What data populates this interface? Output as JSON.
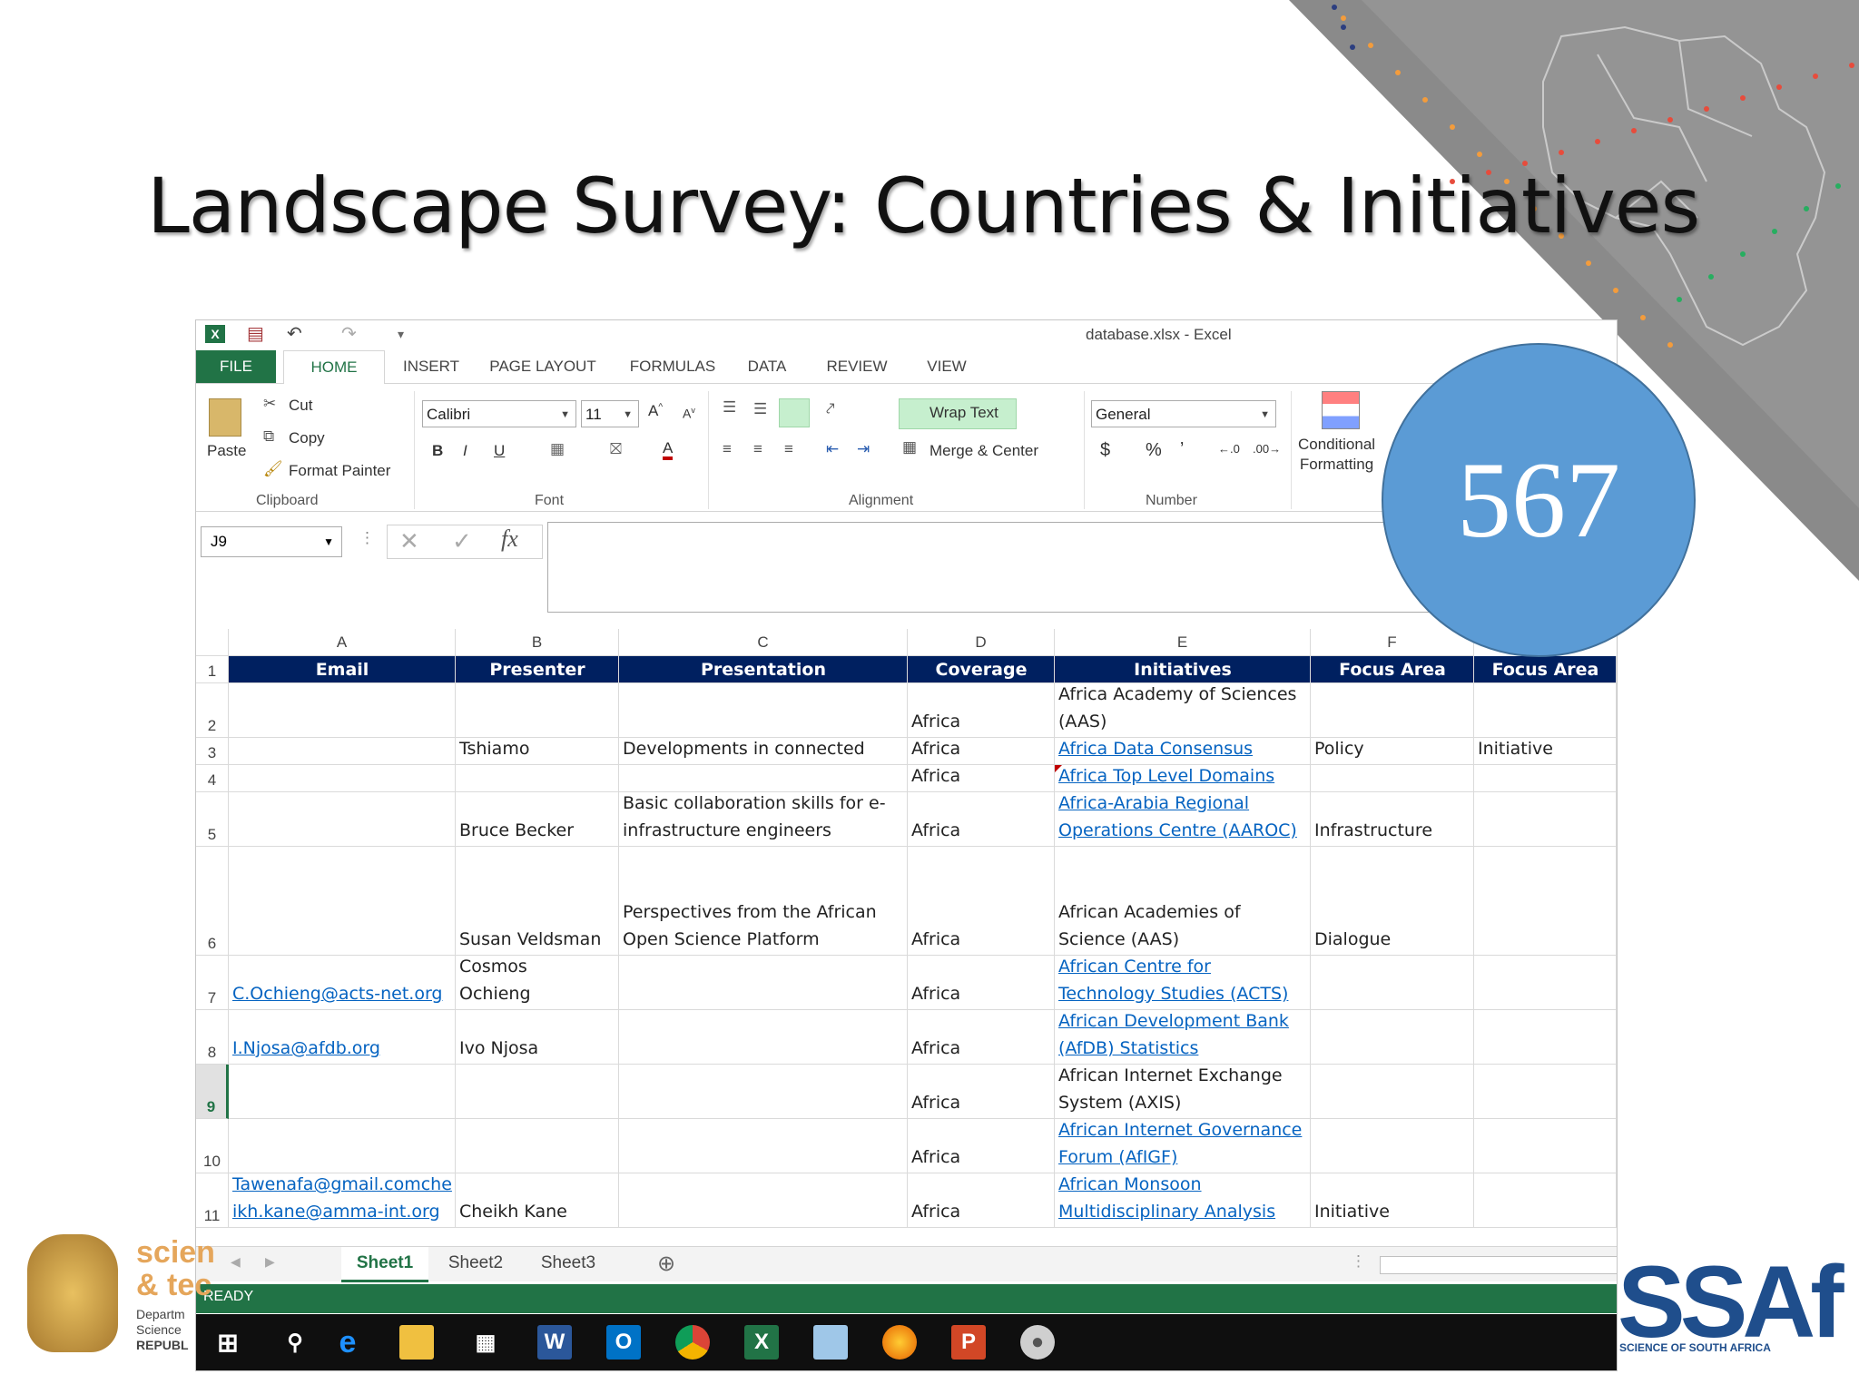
{
  "slide": {
    "title": "Landscape Survey: Countries & Initiatives",
    "badge_number": "567",
    "logo_right": "SSAf",
    "logo_right_sub": "SCIENCE OF SOUTH AFRICA",
    "logo_left_text": [
      "scien",
      "& tec"
    ],
    "logo_left_small": [
      "Departm",
      "Science",
      "REPUBL"
    ]
  },
  "window": {
    "title": "database.xlsx - Excel"
  },
  "ribbon": {
    "tabs": [
      "FILE",
      "HOME",
      "INSERT",
      "PAGE LAYOUT",
      "FORMULAS",
      "DATA",
      "REVIEW",
      "VIEW"
    ],
    "clipboard": {
      "paste": "Paste",
      "cut": "Cut",
      "copy": "Copy",
      "format_painter": "Format Painter",
      "label": "Clipboard"
    },
    "font": {
      "name": "Calibri",
      "size": "11",
      "label": "Font",
      "bold": "B",
      "italic": "I",
      "underline": "U"
    },
    "alignment": {
      "wrap_text": "Wrap Text",
      "merge_center": "Merge & Center",
      "label": "Alignment"
    },
    "number": {
      "format": "General",
      "label": "Number",
      "currency": "$",
      "percent": "%",
      "comma": "ʼ"
    },
    "styles": {
      "conditional": [
        "Conditional",
        "Formatting"
      ]
    }
  },
  "formula_bar": {
    "name_box": "J9",
    "fx": "fx",
    "value": ""
  },
  "sheet": {
    "columns": [
      "A",
      "B",
      "C",
      "D",
      "E",
      "F"
    ],
    "headers": [
      "Email",
      "Presenter",
      "Presentation",
      "Coverage",
      "Initiatives",
      "Focus Area",
      "Focus Area"
    ],
    "rows": [
      {
        "num": "2",
        "cells": [
          [],
          [],
          [],
          [
            "Africa"
          ],
          [
            "Africa Academy of Sciences",
            "(AAS)"
          ],
          [],
          []
        ],
        "links": []
      },
      {
        "num": "3",
        "cells": [
          [],
          [
            "Tshiamo"
          ],
          [
            "Developments in connected"
          ],
          [
            "Africa"
          ],
          [
            "Africa Data Consensus"
          ],
          [
            "Policy"
          ],
          [
            "Initiative"
          ]
        ],
        "links": [
          4
        ]
      },
      {
        "num": "4",
        "cells": [
          [],
          [],
          [],
          [
            "Africa"
          ],
          [
            "Africa Top Level Domains"
          ],
          [],
          []
        ],
        "links": [
          4
        ]
      },
      {
        "num": "5",
        "cells": [
          [],
          [
            "Bruce Becker"
          ],
          [
            "Basic collaboration skills for e-",
            "infrastructure engineers"
          ],
          [
            "Africa"
          ],
          [
            "Africa-Arabia Regional",
            "Operations Centre (AAROC)"
          ],
          [
            "Infrastructure"
          ],
          []
        ],
        "links": [
          4
        ]
      },
      {
        "num": "6",
        "cells": [
          [],
          [
            "Susan Veldsman"
          ],
          [
            "Perspectives from the African",
            "Open Science Platform"
          ],
          [
            "Africa"
          ],
          [
            "African Academies of",
            "Science (AAS)"
          ],
          [
            "Dialogue"
          ],
          []
        ],
        "links": []
      },
      {
        "num": "7",
        "cells": [
          [
            "C.Ochieng@acts-net.org"
          ],
          [
            "Cosmos",
            "Ochieng"
          ],
          [],
          [
            "Africa"
          ],
          [
            "African Centre for",
            "Technology Studies (ACTS)"
          ],
          [],
          []
        ],
        "links": [
          0,
          4
        ]
      },
      {
        "num": "8",
        "cells": [
          [
            "I.Njosa@afdb.org"
          ],
          [
            "Ivo Njosa"
          ],
          [],
          [
            "Africa"
          ],
          [
            "African Development Bank",
            "(AfDB) Statistics"
          ],
          [],
          []
        ],
        "links": [
          0,
          4
        ]
      },
      {
        "num": "9",
        "cells": [
          [],
          [],
          [],
          [
            "Africa"
          ],
          [
            "African Internet Exchange",
            "System (AXIS)"
          ],
          [],
          []
        ],
        "links": []
      },
      {
        "num": "10",
        "cells": [
          [],
          [],
          [],
          [
            "Africa"
          ],
          [
            "African Internet Governance",
            "Forum (AfIGF)"
          ],
          [],
          []
        ],
        "links": [
          4
        ]
      },
      {
        "num": "11",
        "cells": [
          [
            "Tawenafa@gmail.comche",
            "ikh.kane@amma-int.org"
          ],
          [
            "Cheikh  Kane"
          ],
          [],
          [
            "Africa"
          ],
          [
            "African Monsoon",
            "Multidisciplinary Analysis"
          ],
          [
            "Initiative"
          ],
          []
        ],
        "links": [
          0,
          4
        ]
      }
    ],
    "tabs": [
      "Sheet1",
      "Sheet2",
      "Sheet3"
    ]
  },
  "status": {
    "ready": "READY"
  },
  "taskbar": {
    "icons": [
      "windows-start-icon",
      "search-icon",
      "edge-icon",
      "file-explorer-icon",
      "store-icon",
      "word-icon",
      "outlook-icon",
      "chrome-icon",
      "excel-icon",
      "notes-icon",
      "firefox-icon",
      "powerpoint-icon",
      "paint-icon"
    ]
  }
}
